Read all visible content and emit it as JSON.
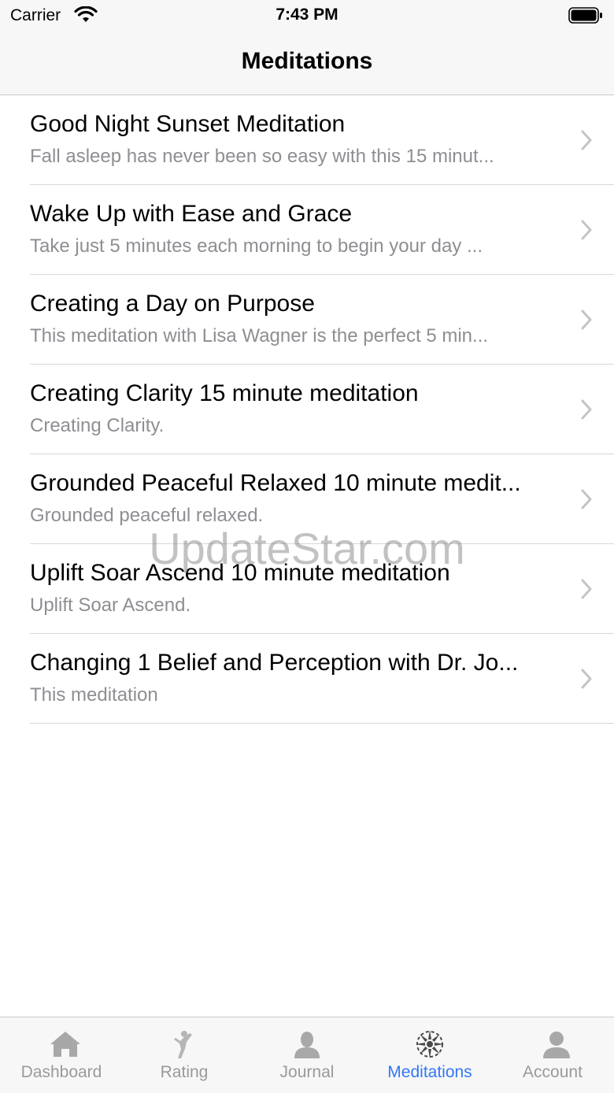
{
  "status_bar": {
    "carrier": "Carrier",
    "time": "7:43 PM"
  },
  "nav": {
    "title": "Meditations"
  },
  "meditations": [
    {
      "title": "Good Night Sunset Meditation",
      "subtitle": "Fall asleep has never been so easy with this 15 minut..."
    },
    {
      "title": "Wake Up with Ease and Grace",
      "subtitle": "Take just 5 minutes each morning to begin your day ..."
    },
    {
      "title": "Creating a Day on Purpose",
      "subtitle": "This meditation with Lisa Wagner is the perfect 5 min..."
    },
    {
      "title": "Creating Clarity 15 minute meditation",
      "subtitle": "Creating Clarity."
    },
    {
      "title": "Grounded Peaceful Relaxed 10 minute medit...",
      "subtitle": "Grounded peaceful relaxed."
    },
    {
      "title": "Uplift Soar Ascend 10 minute meditation",
      "subtitle": "Uplift Soar Ascend."
    },
    {
      "title": "Changing 1 Belief and Perception with Dr. Jo...",
      "subtitle": "This meditation"
    }
  ],
  "watermark": "UpdateStar.com",
  "tab_bar": {
    "tabs": [
      {
        "label": "Dashboard",
        "icon": "house-icon",
        "active": false
      },
      {
        "label": "Rating",
        "icon": "person-stretch-icon",
        "active": false
      },
      {
        "label": "Journal",
        "icon": "person-bust-icon",
        "active": false
      },
      {
        "label": "Meditations",
        "icon": "mandala-icon",
        "active": true
      },
      {
        "label": "Account",
        "icon": "account-icon",
        "active": false
      }
    ]
  },
  "colors": {
    "accent": "#3478f6",
    "secondary_text": "#8e8e93",
    "bar_background": "#f7f7f7"
  }
}
